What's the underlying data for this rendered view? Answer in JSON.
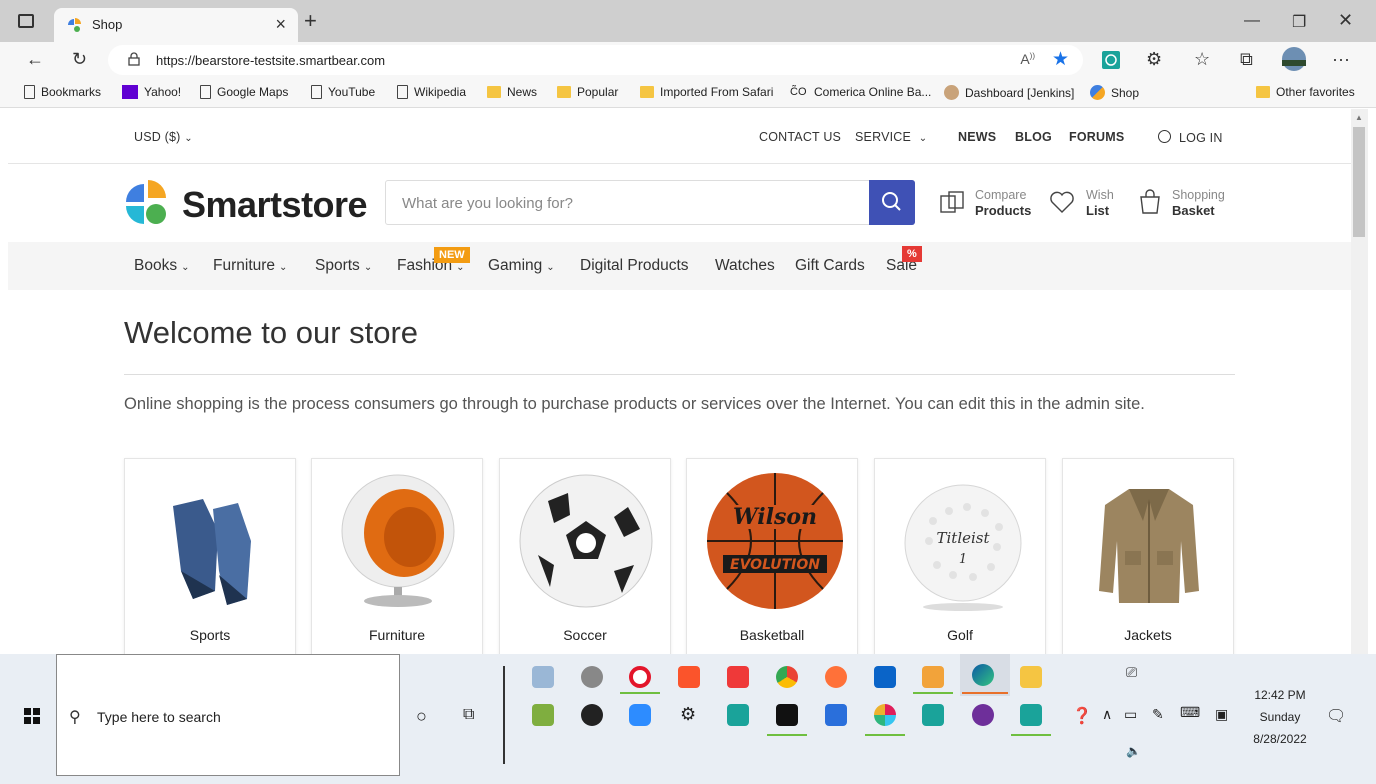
{
  "browser": {
    "tab_title": "Shop",
    "url": "https://bearstore-testsite.smartbear.com",
    "bookmarks": [
      {
        "label": "Bookmarks",
        "icon": "page-icon"
      },
      {
        "label": "Yahoo!",
        "icon": "yahoo-icon"
      },
      {
        "label": "Google Maps",
        "icon": "page-icon"
      },
      {
        "label": "YouTube",
        "icon": "page-icon"
      },
      {
        "label": "Wikipedia",
        "icon": "page-icon"
      },
      {
        "label": "News",
        "icon": "folder-icon"
      },
      {
        "label": "Popular",
        "icon": "folder-icon"
      },
      {
        "label": "Imported From Safari",
        "icon": "folder-icon"
      },
      {
        "label": "Comerica Online Ba...",
        "icon": "comerica-icon"
      },
      {
        "label": "Dashboard [Jenkins]",
        "icon": "jenkins-icon"
      },
      {
        "label": "Shop",
        "icon": "shop-icon"
      }
    ],
    "other_favorites": "Other favorites"
  },
  "store": {
    "currency": "USD  ($)",
    "top_links": {
      "contact": "CONTACT US",
      "service": "SERVICE",
      "news": "NEWS",
      "blog": "BLOG",
      "forums": "FORUMS",
      "login": "LOG IN"
    },
    "logo_text": "Smartstore",
    "search_placeholder": "What are you looking for?",
    "compare": {
      "top": "Compare",
      "bottom": "Products"
    },
    "wishlist": {
      "top": "Wish",
      "bottom": "List"
    },
    "basket": {
      "top": "Shopping",
      "bottom": "Basket"
    },
    "menu": [
      "Books",
      "Furniture",
      "Sports",
      "Fashion",
      "Gaming",
      "Digital Products",
      "Watches",
      "Gift Cards",
      "Sale"
    ],
    "badge_new": "NEW",
    "badge_sale": "%",
    "welcome_title": "Welcome to our store",
    "intro": "Online shopping is the process consumers go through to purchase products or services over the Internet. You can edit this in the admin site.",
    "categories": [
      "Sports",
      "Furniture",
      "Soccer",
      "Basketball",
      "Golf",
      "Jackets"
    ]
  },
  "taskbar": {
    "search_placeholder": "Type here to search",
    "time": "12:42 PM",
    "day": "Sunday",
    "date": "8/28/2022"
  },
  "colors": {
    "brand": "#3f51b5",
    "new_badge": "#f39c12",
    "sale_badge": "#e53935"
  }
}
